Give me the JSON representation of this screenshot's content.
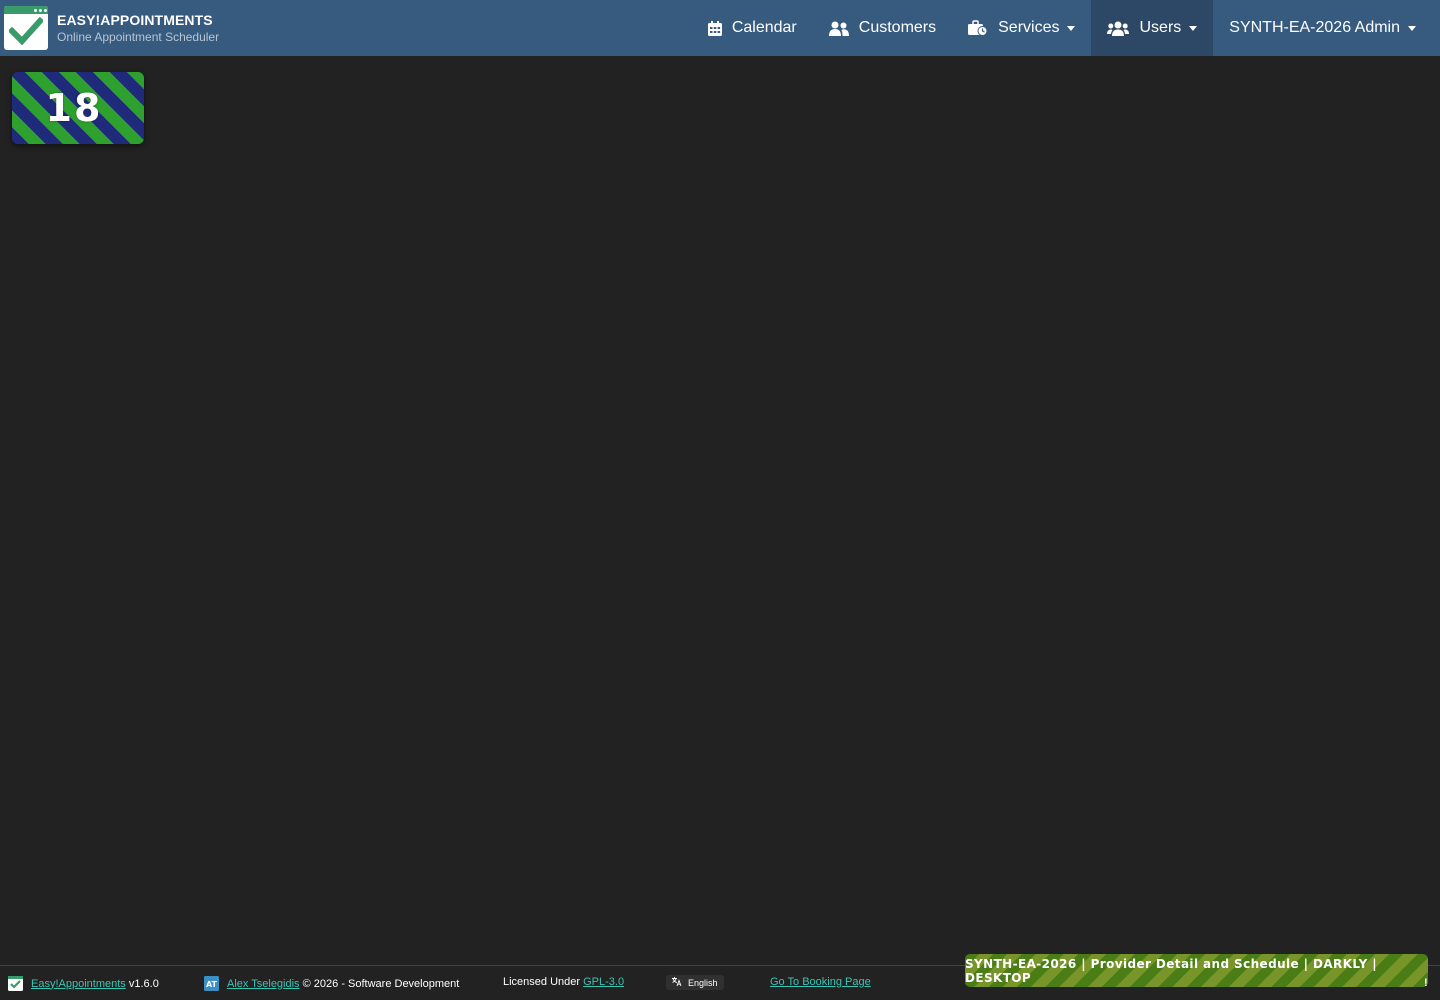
{
  "brand": {
    "title": "EASY!APPOINTMENTS",
    "subtitle": "Online Appointment Scheduler",
    "logo_icon": "checkmark-calendar-icon"
  },
  "nav": {
    "calendar": {
      "label": "Calendar",
      "icon": "calendar-icon"
    },
    "customers": {
      "label": "Customers",
      "icon": "users-icon"
    },
    "services": {
      "label": "Services",
      "icon": "briefcase-clock-icon"
    },
    "users": {
      "label": "Users",
      "icon": "users-group-icon",
      "active": true
    },
    "account": {
      "label": "SYNTH-EA-2026 Admin"
    }
  },
  "tile": {
    "number": "18"
  },
  "footer": {
    "app_link": "Easy!Appointments",
    "version": "v1.6.0",
    "author_link": "Alex Tselegidis",
    "copyright": "© 2026 - Software Development",
    "license_prefix": "Licensed Under",
    "license_link": "GPL-3.0",
    "language": "English",
    "booking_link": "Go To Booking Page",
    "edge_text": "!"
  },
  "banner": {
    "text": "SYNTH-EA-2026 | Provider Detail and Schedule | DARKLY | DESKTOP"
  },
  "colors": {
    "header": "#375a7f",
    "background": "#222222",
    "link": "#3bc4b4",
    "accent_green": "#3a9b6a"
  }
}
